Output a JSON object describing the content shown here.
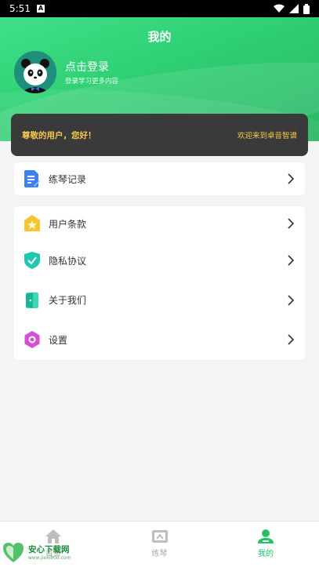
{
  "status_bar": {
    "time": "5:51",
    "notification_glyph": "A"
  },
  "header": {
    "title": "我的",
    "login_title": "点击登录",
    "login_subtitle": "登录学习更多内容",
    "colors": {
      "gradient_start": "#3fe089",
      "gradient_end": "#2ab565"
    }
  },
  "banner": {
    "greeting": "尊敬的用户，您好！",
    "welcome": "欢迎来到卓音智谱",
    "colors": {
      "background": "#3a3a3a",
      "text": "#f5c84c"
    }
  },
  "menu_group_1": [
    {
      "label": "练琴记录",
      "icon": "document-edit-icon"
    }
  ],
  "menu_group_2": [
    {
      "label": "用户条款",
      "icon": "star-tag-icon"
    },
    {
      "label": "隐私协议",
      "icon": "shield-check-icon"
    },
    {
      "label": "关于我们",
      "icon": "door-icon"
    },
    {
      "label": "设置",
      "icon": "hexagon-settings-icon"
    }
  ],
  "tabbar": {
    "tabs": [
      {
        "label": "首页",
        "icon": "home-icon",
        "active": false
      },
      {
        "label": "练琴",
        "icon": "piano-icon",
        "active": false
      },
      {
        "label": "我的",
        "icon": "user-icon",
        "active": true
      }
    ],
    "active_color": "#27c165"
  },
  "watermark": {
    "title": "安心下载网",
    "url": "www.jiexi800.com"
  }
}
